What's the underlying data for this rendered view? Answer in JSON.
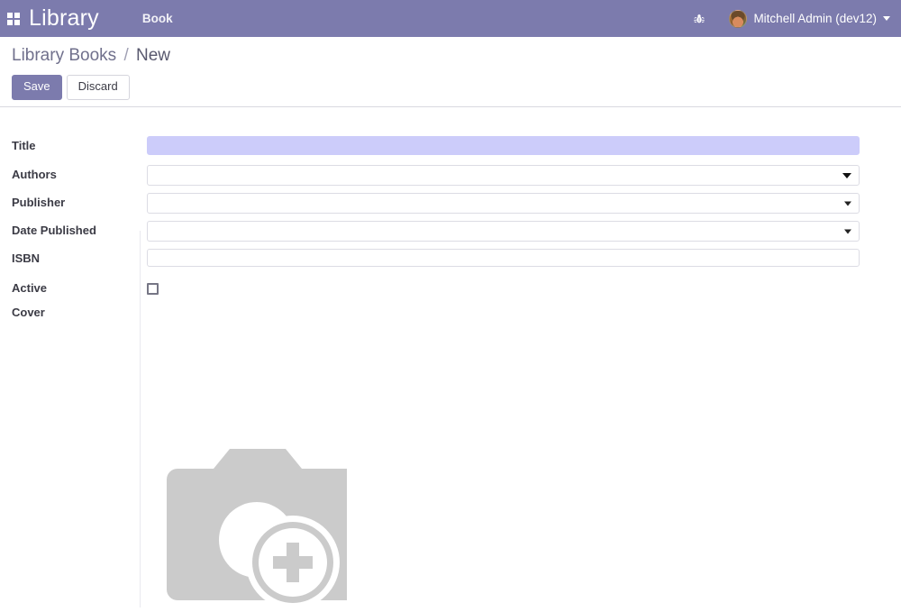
{
  "navbar": {
    "apps_icon": "apps-grid-icon",
    "brand": "Library",
    "menu_items": [
      {
        "label": "Book"
      }
    ],
    "debug_icon": "bug-icon",
    "user": {
      "avatar": "user-avatar",
      "name": "Mitchell Admin (dev12)",
      "caret": "chevron-down-icon"
    }
  },
  "control_panel": {
    "breadcrumb": {
      "parent": "Library Books",
      "separator": "/",
      "current": "New"
    },
    "buttons": {
      "save": "Save",
      "discard": "Discard"
    }
  },
  "form": {
    "fields": [
      {
        "label": "Title",
        "type": "text",
        "value": "",
        "placeholder": "",
        "focused": true
      },
      {
        "label": "Authors",
        "type": "many2many",
        "value": "",
        "placeholder": ""
      },
      {
        "label": "Publisher",
        "type": "many2one",
        "value": "",
        "placeholder": ""
      },
      {
        "label": "Date Published",
        "type": "many2one",
        "value": "",
        "placeholder": ""
      },
      {
        "label": "ISBN",
        "type": "text",
        "value": "",
        "placeholder": ""
      },
      {
        "label": "Active",
        "type": "boolean",
        "checked": false
      },
      {
        "label": "Cover",
        "type": "image",
        "placeholder_icon": "camera-add-photo-icon"
      }
    ]
  },
  "colors": {
    "brand_purple": "#7c7bad",
    "focused_field": "#ccccfa",
    "placeholder_gray": "#cccccc",
    "label_text": "#3b3b45",
    "breadcrumb_text": "#6b6b85"
  }
}
